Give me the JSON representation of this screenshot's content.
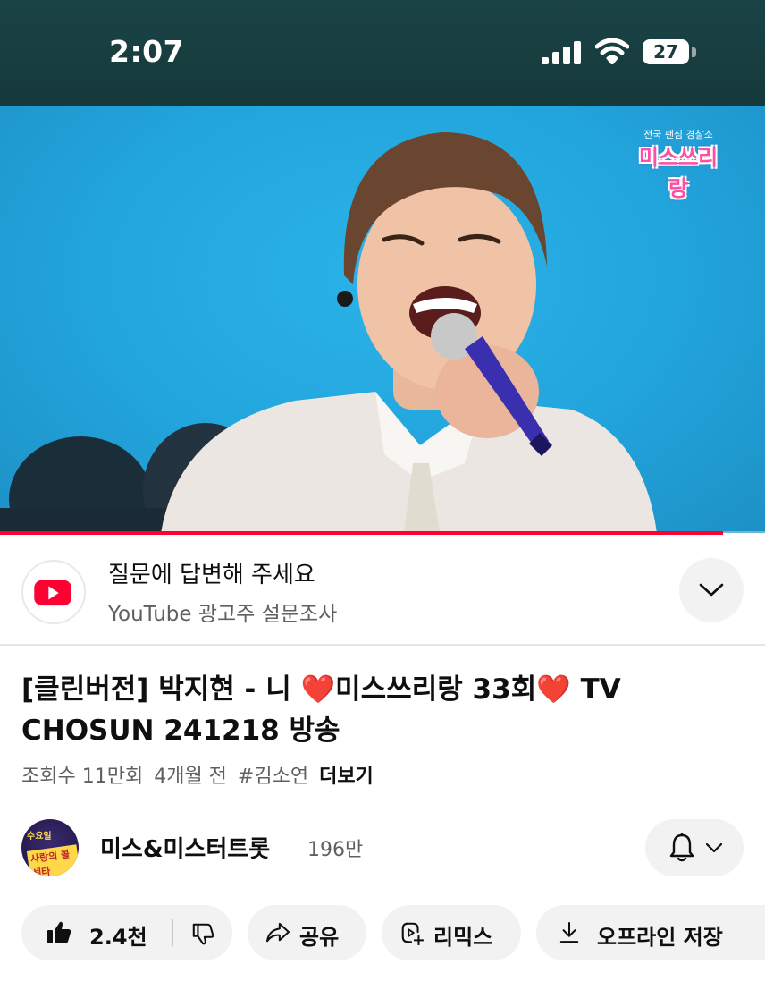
{
  "status_bar": {
    "time": "2:07",
    "battery_level": "27",
    "icons": [
      "cellular-signal-icon",
      "wifi-icon",
      "battery-icon"
    ]
  },
  "video": {
    "watermark": {
      "subtitle": "전국 팬심 경찰소",
      "title": "미스쓰리랑"
    },
    "progress_fraction": 0.945,
    "progress_color": "#ff0033"
  },
  "survey": {
    "title": "질문에 답변해 주세요",
    "subtitle": "YouTube 광고주 설문조사",
    "icons": [
      "youtube-logo-icon",
      "chevron-down-icon"
    ]
  },
  "video_info": {
    "title_part1": "[클린버전] 박지현 - 니 ",
    "title_heart": "❤️",
    "title_part2": "미스쓰리랑 33회",
    "title_part3": " TV CHOSUN 241218 방송",
    "views": "조회수 11만회",
    "age": "4개월 전",
    "hashtag": "#김소연",
    "more_label": "더보기"
  },
  "channel": {
    "name": "미스&미스터트롯",
    "subscribers": "196만",
    "avatar_text_top": "수요일",
    "avatar_text_bottom": "사랑의 콜센타"
  },
  "actions": {
    "like_count": "2.4천",
    "share_label": "공유",
    "remix_label": "리믹스",
    "download_label": "오프라인 저장",
    "icons": [
      "thumbs-up-icon",
      "thumbs-down-icon",
      "share-icon",
      "remix-icon",
      "download-icon",
      "bell-icon"
    ]
  },
  "colors": {
    "accent_red": "#ff0033",
    "heart_red": "#e0202e",
    "video_bg": "#22a4dc",
    "status_bar_bg": "#1a4345"
  }
}
